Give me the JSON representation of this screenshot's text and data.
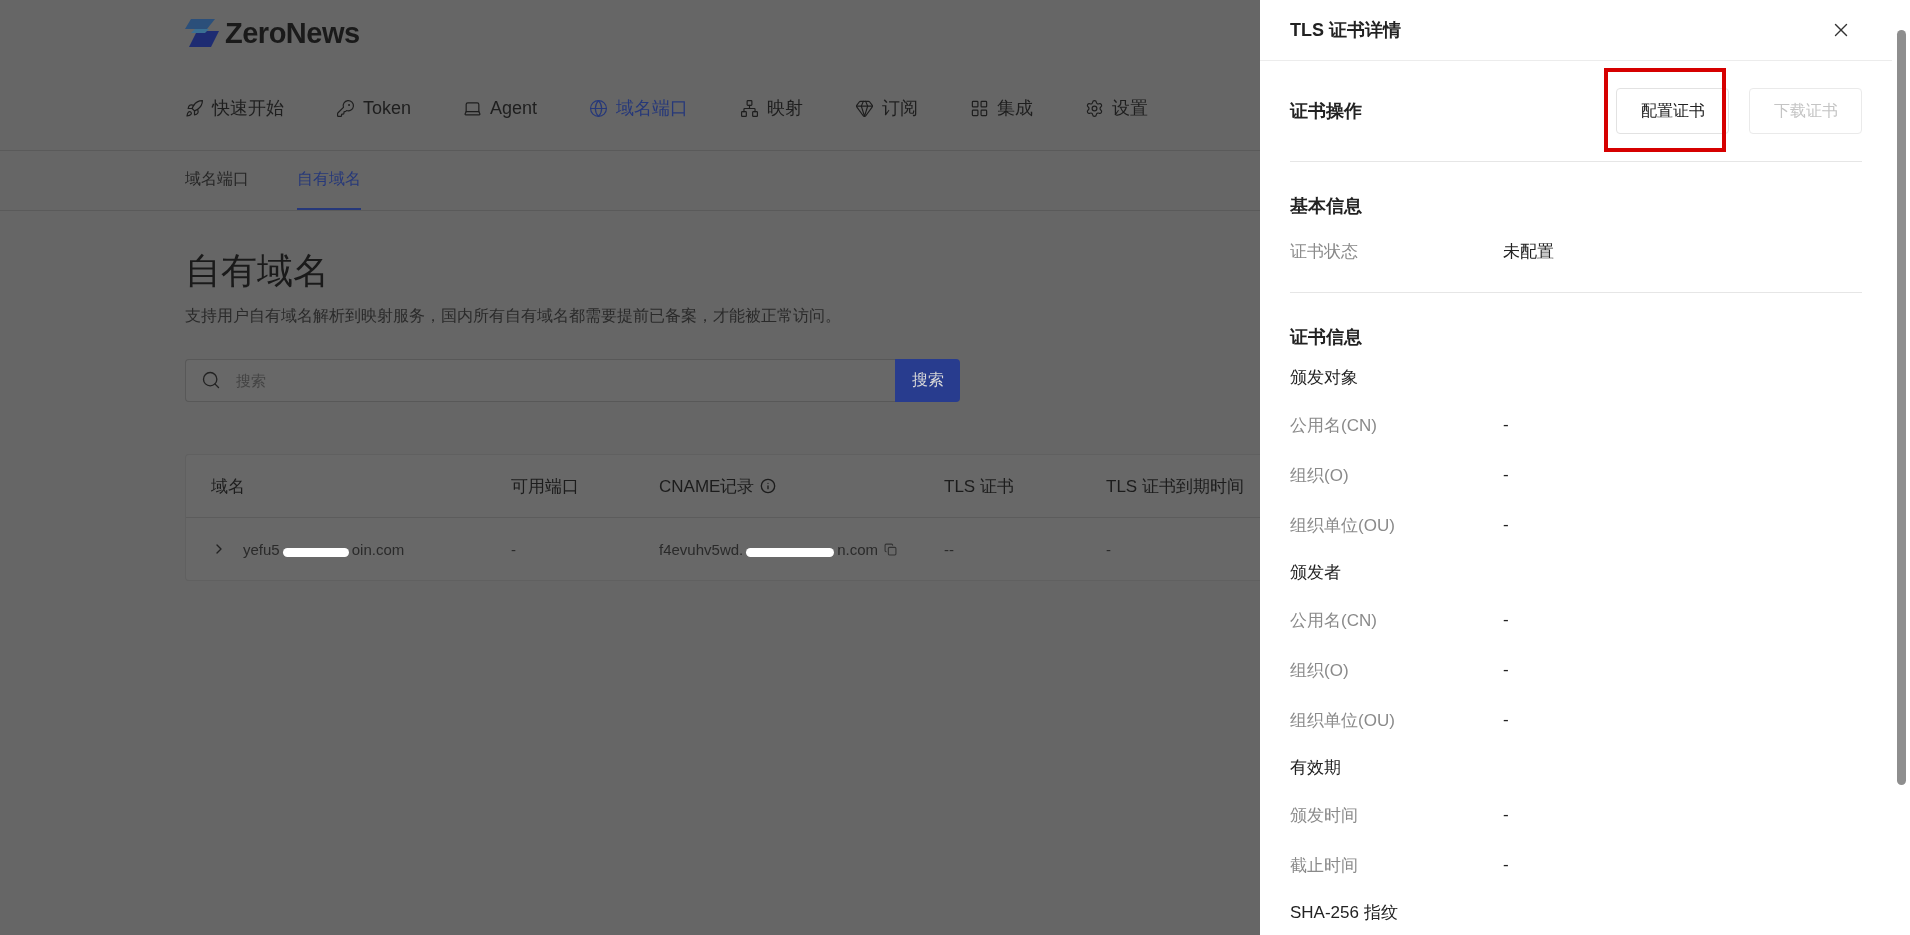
{
  "logo": {
    "text": "ZeroNews"
  },
  "nav": [
    {
      "label": "快速开始",
      "selected": false
    },
    {
      "label": "Token",
      "selected": false
    },
    {
      "label": "Agent",
      "selected": false
    },
    {
      "label": "域名端口",
      "selected": true
    },
    {
      "label": "映射",
      "selected": false
    },
    {
      "label": "订阅",
      "selected": false
    },
    {
      "label": "集成",
      "selected": false
    },
    {
      "label": "设置",
      "selected": false
    }
  ],
  "sub_tabs": [
    {
      "label": "域名端口",
      "selected": false
    },
    {
      "label": "自有域名",
      "selected": true
    }
  ],
  "page": {
    "title": "自有域名",
    "description": "支持用户自有域名解析到映射服务，国内所有自有域名都需要提前已备案，才能被正常访问。"
  },
  "search": {
    "placeholder": "搜索",
    "button": "搜索"
  },
  "table": {
    "columns": [
      {
        "label": "域名",
        "info": false
      },
      {
        "label": "可用端口",
        "info": false
      },
      {
        "label": "CNAME记录",
        "info": true
      },
      {
        "label": "TLS 证书",
        "info": false
      },
      {
        "label": "TLS 证书到期时间",
        "info": false
      }
    ],
    "rows": [
      {
        "expanded": false,
        "domain_start": "yefu5",
        "domain_end": "oin.com",
        "port": "-",
        "cname_start": "f4evuhv5wd.",
        "cname_end": "n.com",
        "copyable": true,
        "tls": "--",
        "expiry": "-"
      }
    ]
  },
  "drawer": {
    "title": "TLS 证书详情",
    "actions": {
      "label": "证书操作",
      "buttons": [
        {
          "label": "配置证书",
          "disabled": false,
          "highlighted": true
        },
        {
          "label": "下载证书",
          "disabled": true,
          "highlighted": false
        }
      ]
    },
    "basic": {
      "title": "基本信息",
      "fields": [
        {
          "label": "证书状态",
          "value": "未配置"
        }
      ]
    },
    "cert": {
      "title": "证书信息",
      "groups": [
        {
          "title": "颁发对象",
          "fields": [
            {
              "label": "公用名(CN)",
              "value": "-"
            },
            {
              "label": "组织(O)",
              "value": "-"
            },
            {
              "label": "组织单位(OU)",
              "value": "-"
            }
          ]
        },
        {
          "title": "颁发者",
          "fields": [
            {
              "label": "公用名(CN)",
              "value": "-"
            },
            {
              "label": "组织(O)",
              "value": "-"
            },
            {
              "label": "组织单位(OU)",
              "value": "-"
            }
          ]
        },
        {
          "title": "有效期",
          "fields": [
            {
              "label": "颁发时间",
              "value": "-"
            },
            {
              "label": "截止时间",
              "value": "-"
            }
          ]
        },
        {
          "title": "SHA-256 指纹"
        }
      ]
    }
  }
}
